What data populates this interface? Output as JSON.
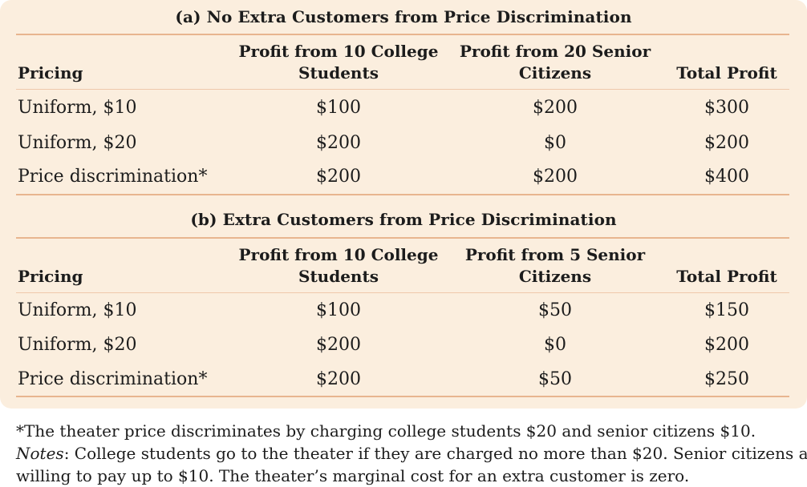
{
  "panel_a": {
    "title": "(a) No Extra Customers from Price Discrimination",
    "headers": [
      "Pricing",
      "Profit from 10 College\nStudents",
      "Profit from 20 Senior\nCitizens",
      "Total Profit"
    ],
    "header_lines": {
      "col1": [
        "Profit from 10 College",
        "Students"
      ],
      "col2": [
        "Profit from 20 Senior",
        "Citizens"
      ]
    },
    "rows": [
      [
        "Uniform, $10",
        "$100",
        "$200",
        "$300"
      ],
      [
        "Uniform, $20",
        "$200",
        "$0",
        "$200"
      ],
      [
        "Price discrimination*",
        "$200",
        "$200",
        "$400"
      ]
    ]
  },
  "panel_b": {
    "title": "(b) Extra Customers from Price Discrimination",
    "header_lines": {
      "col1": [
        "Profit from 10 College",
        "Students"
      ],
      "col2": [
        "Profit from 5 Senior",
        "Citizens"
      ]
    },
    "rows": [
      [
        "Uniform, $10",
        "$100",
        "$50",
        "$150"
      ],
      [
        "Uniform, $20",
        "$200",
        "$0",
        "$200"
      ],
      [
        "Price discrimination*",
        "$200",
        "$50",
        "$250"
      ]
    ]
  },
  "header_pricing": "Pricing",
  "header_total": "Total Profit",
  "footnote": "*The theater price discriminates by charging college students $20 and senior citizens $10.",
  "notes_label": "Notes",
  "notes_text_1": ": College students go to the theater if they are charged no more than $20. Senior citizens are",
  "notes_text_2": "willing to pay up to $10. The theater’s marginal cost for an extra customer is zero."
}
